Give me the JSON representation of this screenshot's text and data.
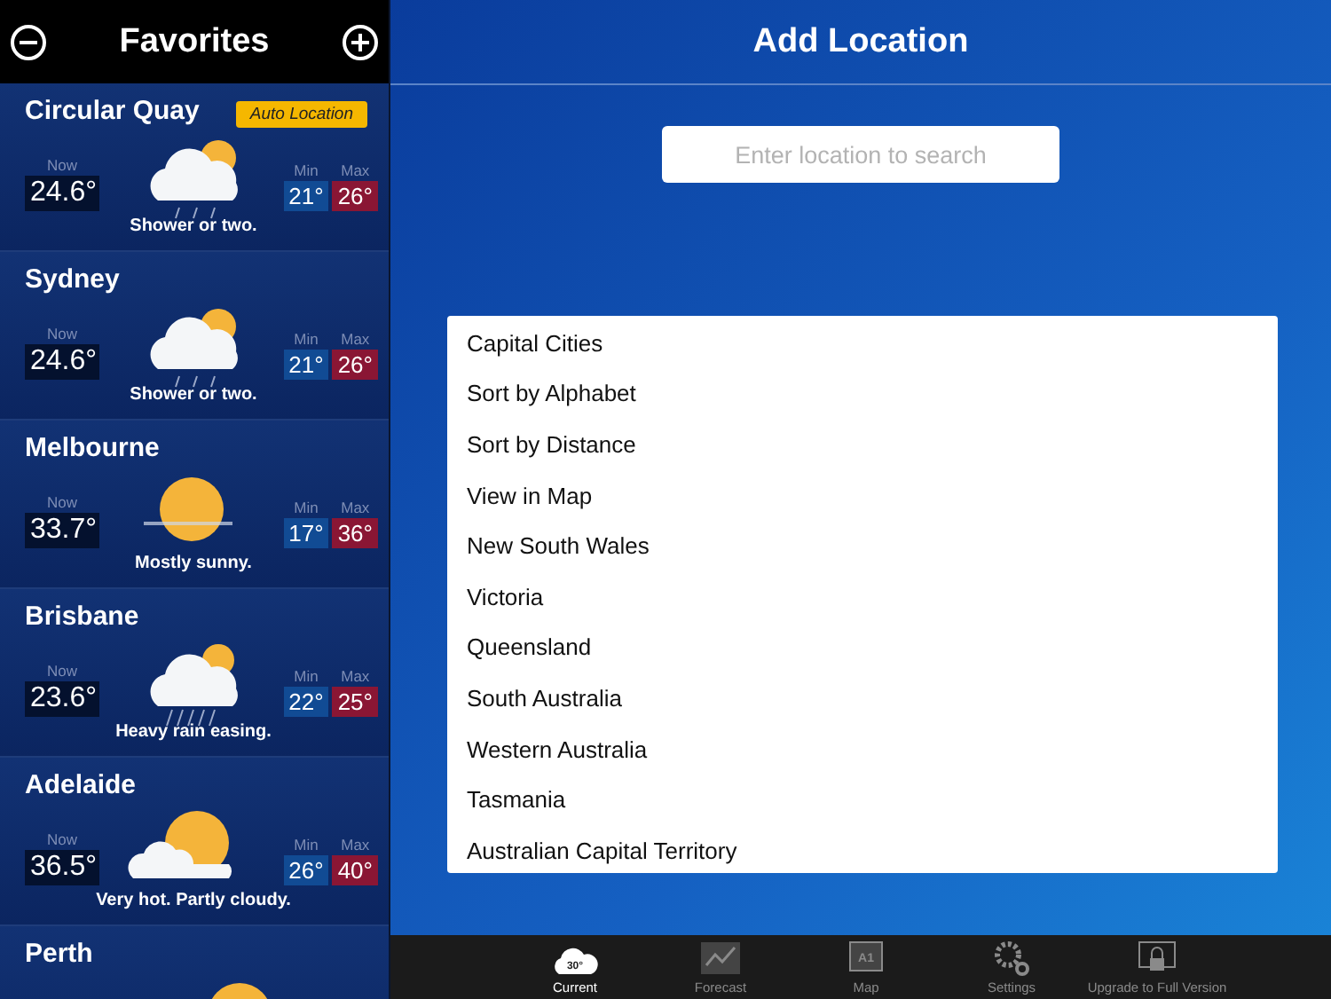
{
  "sidebar": {
    "title": "Favorites",
    "locations": [
      {
        "name": "Circular Quay",
        "badge": "Auto Location",
        "now_label": "Now",
        "now": "24.6°",
        "kind": "shower",
        "summary": "Shower or two.",
        "min_label": "Min",
        "min": "21°",
        "max_label": "Max",
        "max": "26°"
      },
      {
        "name": "Sydney",
        "now_label": "Now",
        "now": "24.6°",
        "kind": "shower",
        "summary": "Shower or two.",
        "min_label": "Min",
        "min": "21°",
        "max_label": "Max",
        "max": "26°"
      },
      {
        "name": "Melbourne",
        "now_label": "Now",
        "now": "33.7°",
        "kind": "sunny",
        "summary": "Mostly sunny.",
        "min_label": "Min",
        "min": "17°",
        "max_label": "Max",
        "max": "36°"
      },
      {
        "name": "Brisbane",
        "now_label": "Now",
        "now": "23.6°",
        "kind": "rain",
        "summary": "Heavy rain easing.",
        "min_label": "Min",
        "min": "22°",
        "max_label": "Max",
        "max": "25°"
      },
      {
        "name": "Adelaide",
        "now_label": "Now",
        "now": "36.5°",
        "kind": "partly",
        "summary": "Very hot. Partly cloudy.",
        "min_label": "Min",
        "min": "26°",
        "max_label": "Max",
        "max": "40°"
      },
      {
        "name": "Perth",
        "kind": "sunny"
      }
    ]
  },
  "main": {
    "title": "Add Location",
    "search": {
      "placeholder": "Enter location to search"
    },
    "options": [
      "Capital Cities",
      "Sort by Alphabet",
      "Sort by Distance",
      "View in Map",
      "New South Wales",
      "Victoria",
      "Queensland",
      "South Australia",
      "Western Australia",
      "Tasmania",
      "Australian Capital Territory"
    ]
  },
  "tab_bar": [
    {
      "kind": "current",
      "label": "Current",
      "icon_text": "30°",
      "selected": true
    },
    {
      "kind": "forecast",
      "label": "Forecast",
      "selected": false
    },
    {
      "kind": "map",
      "label": "Map",
      "icon_text": "A1",
      "selected": false
    },
    {
      "kind": "settings",
      "label": "Settings",
      "selected": false
    },
    {
      "kind": "upgrade",
      "label": "Upgrade to Full Version",
      "selected": false
    }
  ]
}
